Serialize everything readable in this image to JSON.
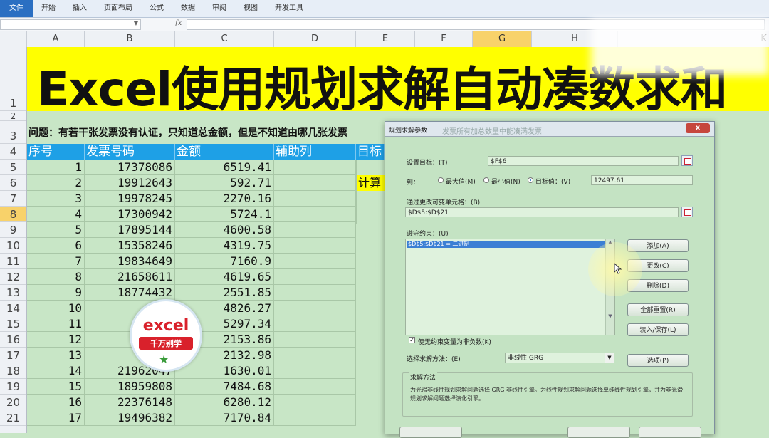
{
  "ribbon": {
    "tabs": [
      "文件",
      "开始",
      "插入",
      "页面布局",
      "公式",
      "数据",
      "审阅",
      "视图",
      "开发工具"
    ]
  },
  "formula_bar": {
    "fx": "fx"
  },
  "columns": [
    "A",
    "B",
    "C",
    "D",
    "E",
    "F",
    "G",
    "H",
    "K"
  ],
  "selected_column": "G",
  "rows": [
    "1",
    "2",
    "3",
    "4",
    "5",
    "6",
    "7",
    "8",
    "9",
    "10",
    "11",
    "12",
    "13",
    "14",
    "15",
    "16",
    "17",
    "18",
    "19",
    "20",
    "21"
  ],
  "selected_row": "8",
  "banner_title": "Excel使用规划求解自动凑数求和",
  "question": "问题：有若干张发票没有认证，只知道总金额，但是不知道由哪几张发票",
  "headers": {
    "seq": "序号",
    "invoice": "发票号码",
    "amount": "金额",
    "helper": "辅助列",
    "target": "目标",
    "calc": "计算"
  },
  "table": [
    {
      "seq": "1",
      "invoice": "17378086",
      "amount": "6519.41"
    },
    {
      "seq": "2",
      "invoice": "19912643",
      "amount": "592.71"
    },
    {
      "seq": "3",
      "invoice": "19978245",
      "amount": "2270.16"
    },
    {
      "seq": "4",
      "invoice": "17300942",
      "amount": "5724.1"
    },
    {
      "seq": "5",
      "invoice": "17895144",
      "amount": "4600.58"
    },
    {
      "seq": "6",
      "invoice": "15358246",
      "amount": "4319.75"
    },
    {
      "seq": "7",
      "invoice": "19834649",
      "amount": "7160.9"
    },
    {
      "seq": "8",
      "invoice": "21658611",
      "amount": "4619.65"
    },
    {
      "seq": "9",
      "invoice": "18774432",
      "amount": "2551.85"
    },
    {
      "seq": "10",
      "invoice": "18",
      "amount": "4826.27"
    },
    {
      "seq": "11",
      "invoice": "1",
      "amount": "5297.34"
    },
    {
      "seq": "12",
      "invoice": "1",
      "amount": "2153.86"
    },
    {
      "seq": "13",
      "invoice": "171",
      "amount": "2132.98"
    },
    {
      "seq": "14",
      "invoice": "21962047",
      "amount": "1630.01"
    },
    {
      "seq": "15",
      "invoice": "18959808",
      "amount": "7484.68"
    },
    {
      "seq": "16",
      "invoice": "22376148",
      "amount": "6280.12"
    },
    {
      "seq": "17",
      "invoice": "19496382",
      "amount": "7170.84"
    }
  ],
  "watermark": {
    "line1": "excel",
    "line2": "千万别学"
  },
  "dialog": {
    "title": "规划求解参数",
    "ghost_text": "发票所有加总数量中能凑满发票",
    "close": "x",
    "set_objective_label": "设置目标：(T)",
    "set_objective_value": "$F$6",
    "to_label": "到：",
    "opt_max": "最大值(M)",
    "opt_min": "最小值(N)",
    "opt_value": "目标值：(V)",
    "target_value": "12497.61",
    "changing_label": "通过更改可变单元格：(B)",
    "changing_value": "$D$5:$D$21",
    "constraints_label": "遵守约束：(U)",
    "constraint_item": "$D$5:$D$21 = 二进制",
    "btn_add": "添加(A)",
    "btn_change": "更改(C)",
    "btn_delete": "删除(D)",
    "btn_reset": "全部重置(R)",
    "btn_loadsave": "装入/保存(L)",
    "nonneg_label": "使无约束变量为非负数(K)",
    "method_label": "选择求解方法：(E)",
    "method_value": "非线性 GRG",
    "btn_options": "选项(P)",
    "method_group_title": "求解方法",
    "method_desc": "为光滑非线性规划求解问题选择 GRG 非线性引擎。为线性规划求解问题选择单纯线性规划引擎，并为非光滑规划求解问题选择演化引擎。"
  }
}
